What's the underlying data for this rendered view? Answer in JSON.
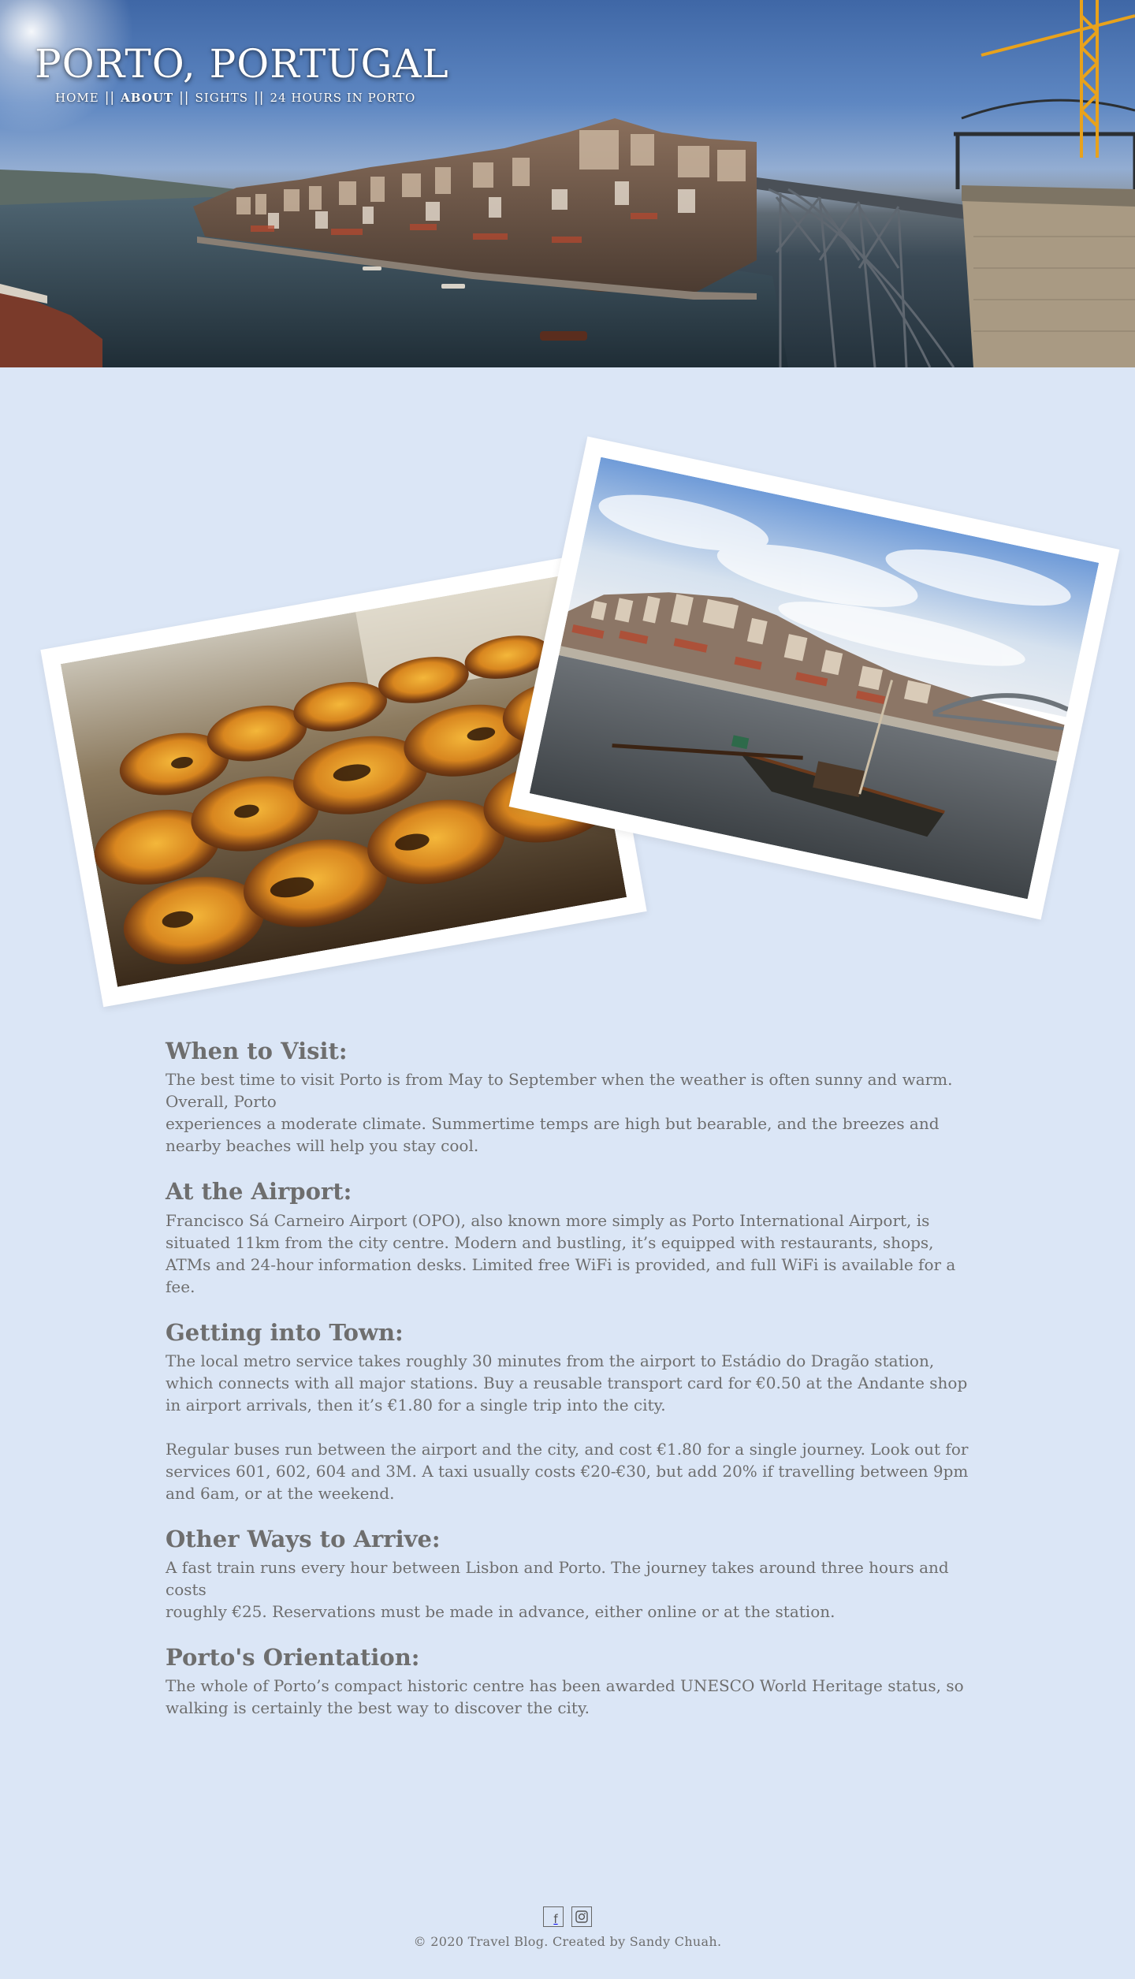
{
  "site": {
    "title": "PORTO, PORTUGAL"
  },
  "nav": {
    "items": [
      {
        "label": "HOME",
        "active": false
      },
      {
        "label": "ABOUT",
        "active": true
      },
      {
        "label": "SIGHTS",
        "active": false
      },
      {
        "label": "24 HOURS IN PORTO",
        "active": false
      }
    ],
    "separator": "||"
  },
  "gallery": {
    "images": [
      {
        "subject": "pastel de nata custard tarts"
      },
      {
        "subject": "Douro river with rabelo boat"
      }
    ]
  },
  "sections": [
    {
      "heading": "When to Visit:",
      "paragraphs": [
        "The best time to visit Porto is from May to September when the weather is often sunny and warm. Overall, Porto",
        "experiences a moderate climate. Summertime temps are high but bearable, and the breezes and nearby beaches will help you stay cool."
      ]
    },
    {
      "heading": "At the Airport:",
      "paragraphs": [
        "Francisco Sá Carneiro Airport (OPO), also known more simply as Porto International Airport, is situated 11km from the city centre. Modern and bustling, it’s equipped with restaurants, shops, ATMs and 24-hour information desks. Limited free WiFi is provided, and full WiFi is available for a fee."
      ]
    },
    {
      "heading": "Getting into Town:",
      "paragraphs": [
        "The local metro service takes roughly 30 minutes from the airport to Estádio do Dragão station, which connects with all major stations. Buy a reusable transport card for €0.50 at the Andante shop in airport arrivals, then it’s €1.80 for a single trip into the city.",
        "Regular buses run between the airport and the city, and cost €1.80 for a single journey. Look out for services 601, 602, 604 and 3M. A taxi usually costs €20-€30, but add 20% if travelling between 9pm and 6am, or at the weekend."
      ]
    },
    {
      "heading": "Other Ways to Arrive:",
      "paragraphs": [
        "A fast train runs every hour between Lisbon and Porto. The journey takes around three hours and costs",
        "roughly €25. Reservations must be made in advance, either online or at the station."
      ]
    },
    {
      "heading": "Porto's Orientation:",
      "paragraphs": [
        "The whole of Porto’s compact historic centre has been awarded UNESCO World Heritage status, so walking is certainly the best way to discover the city."
      ]
    }
  ],
  "footer": {
    "social": [
      {
        "icon": "facebook-icon",
        "glyph": "f"
      },
      {
        "icon": "instagram-icon",
        "glyph": ""
      }
    ],
    "copyright": "© 2020 Travel Blog.  Created by Sandy Chuah."
  },
  "colors": {
    "page_background": "#dbe6f6",
    "text": "#6e6e6e",
    "title_text": "#ffffff",
    "photo_border": "#ffffff"
  }
}
